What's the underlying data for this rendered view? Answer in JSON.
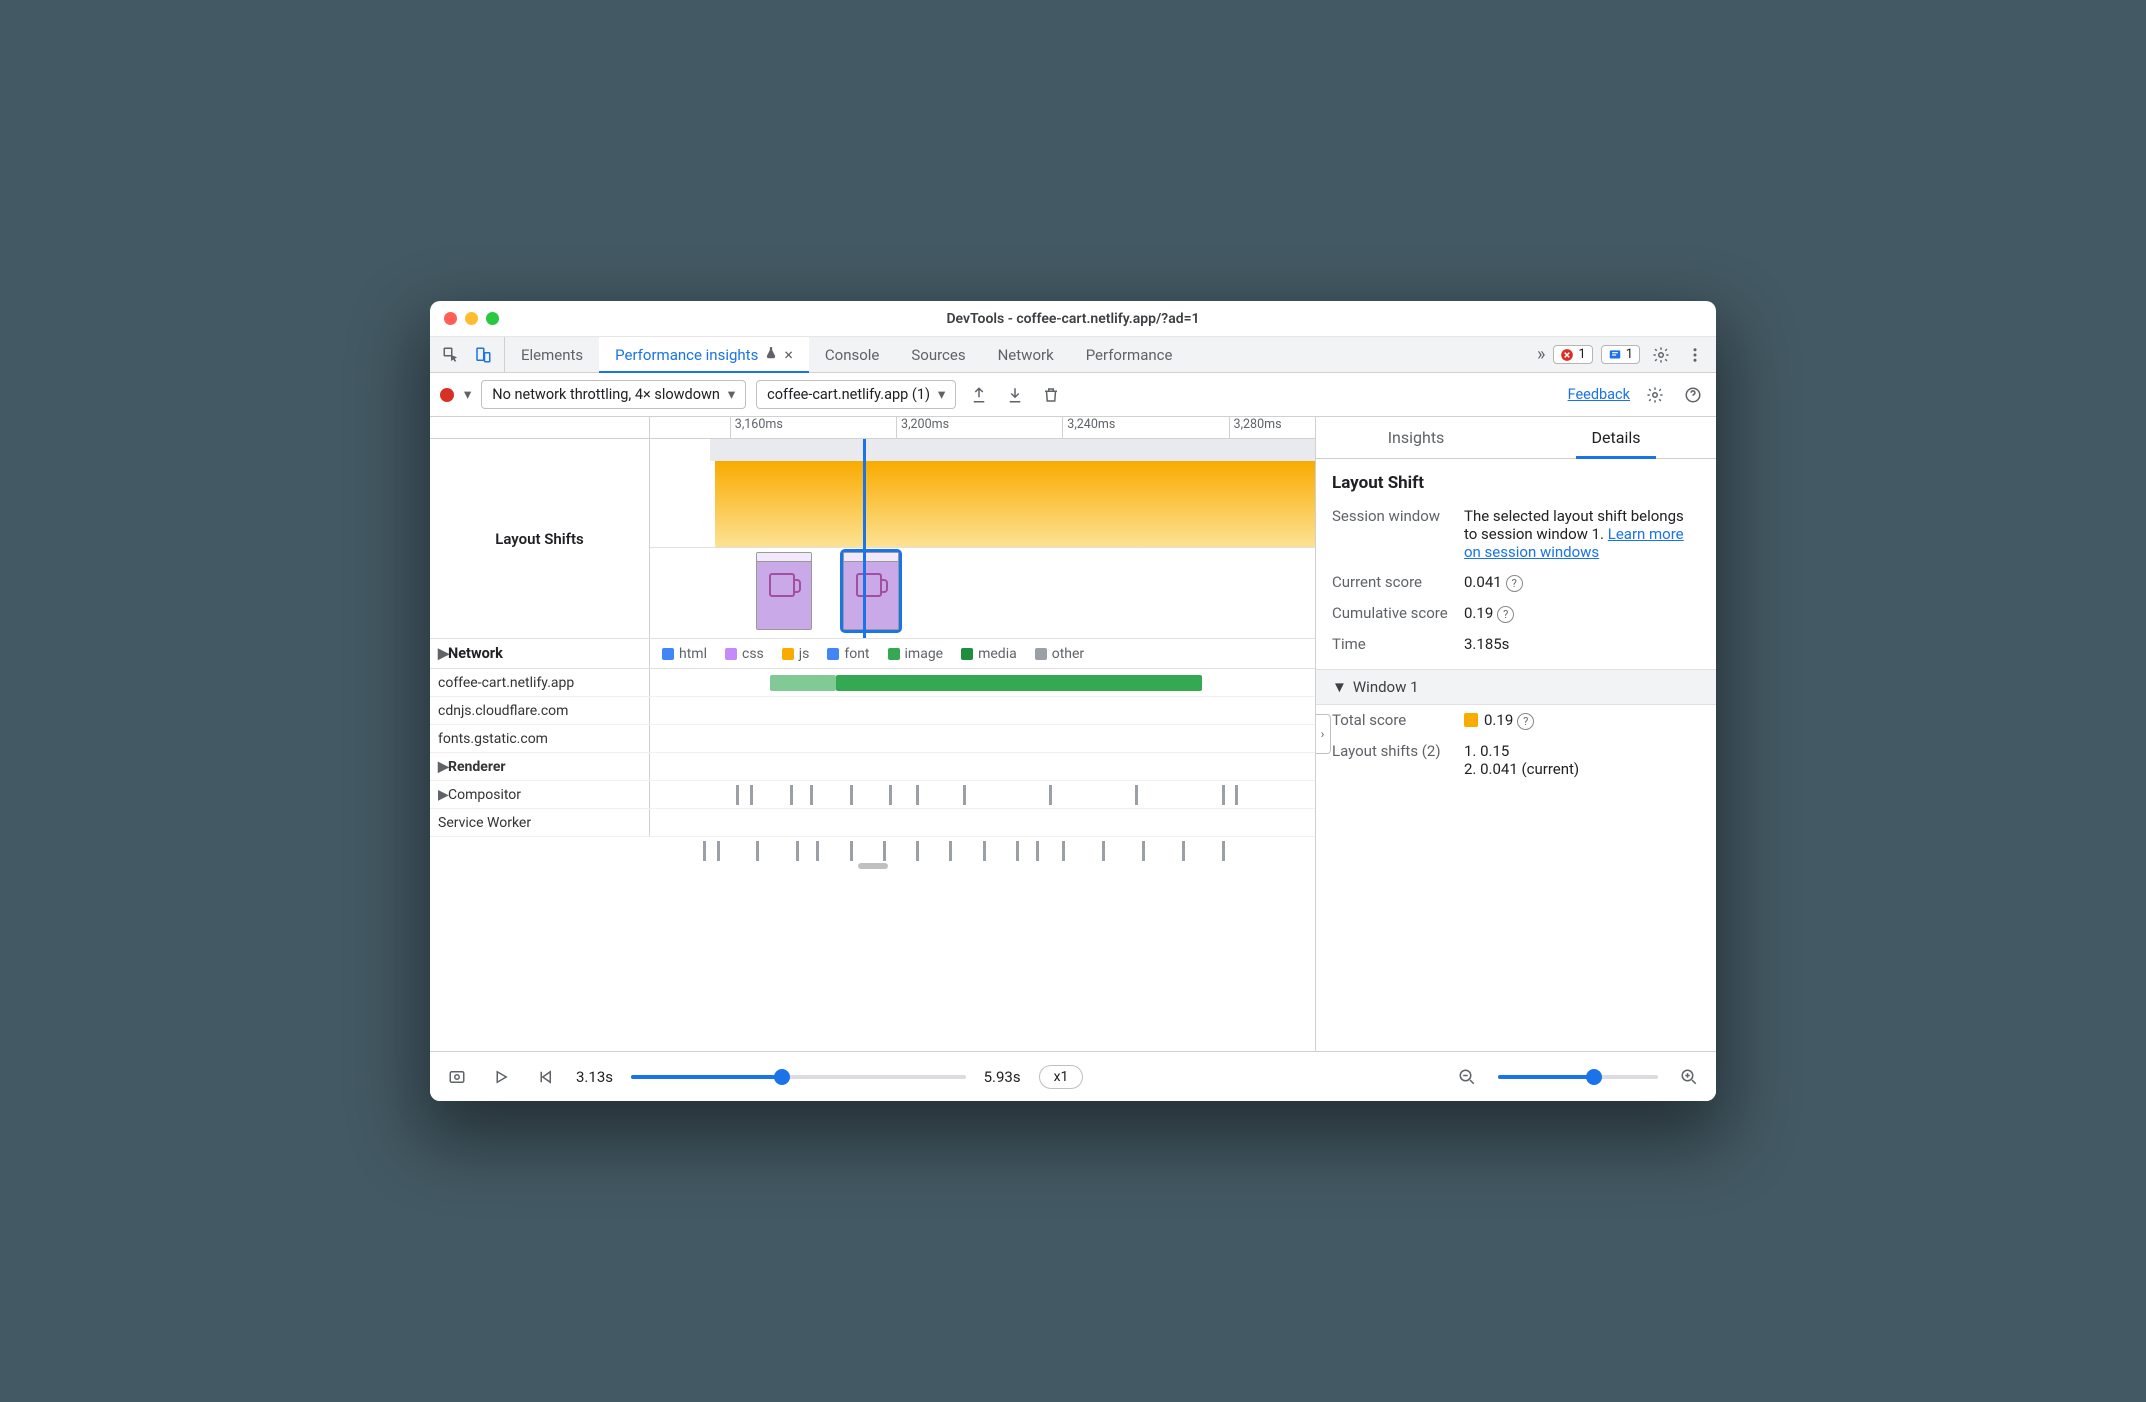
{
  "window": {
    "title": "DevTools - coffee-cart.netlify.app/?ad=1"
  },
  "tabs": {
    "items": [
      "Elements",
      "Performance insights",
      "Console",
      "Sources",
      "Network",
      "Performance"
    ],
    "active_index": 1,
    "close_visible": true,
    "errors": "1",
    "issues": "1"
  },
  "toolbar": {
    "throttling": "No network throttling, 4× slowdown",
    "recording": "coffee-cart.netlify.app (1)",
    "feedback": "Feedback"
  },
  "ruler": {
    "ticks": [
      {
        "label": "3,160ms",
        "left_pct": 12
      },
      {
        "label": "3,200ms",
        "left_pct": 37
      },
      {
        "label": "3,240ms",
        "left_pct": 62
      },
      {
        "label": "3,280ms",
        "left_pct": 87
      }
    ]
  },
  "layout_shifts": {
    "label": "Layout Shifts",
    "playhead_left_pct": 32,
    "thumbs": [
      {
        "left_pct": 16,
        "selected": false
      },
      {
        "left_pct": 29,
        "selected": true
      }
    ]
  },
  "network": {
    "label": "Network",
    "legend": [
      {
        "name": "html",
        "color": "#4285f4"
      },
      {
        "name": "css",
        "color": "#c58af9"
      },
      {
        "name": "js",
        "color": "#f9ab00"
      },
      {
        "name": "font",
        "color": "#4285f4"
      },
      {
        "name": "image",
        "color": "#34a853"
      },
      {
        "name": "media",
        "color": "#1e8e3e"
      },
      {
        "name": "other",
        "color": "#9aa0a6"
      }
    ],
    "rows": [
      {
        "host": "coffee-cart.netlify.app",
        "bars": [
          {
            "left_pct": 18,
            "width_pct": 10,
            "color": "#81c995"
          },
          {
            "left_pct": 28,
            "width_pct": 55,
            "color": "#34a853"
          }
        ]
      },
      {
        "host": "cdnjs.cloudflare.com",
        "bars": []
      },
      {
        "host": "fonts.gstatic.com",
        "bars": []
      }
    ]
  },
  "renderer": {
    "label": "Renderer",
    "compositor": "Compositor",
    "service_worker": "Service Worker",
    "ticks_pct": [
      13,
      15,
      21,
      24,
      30,
      36,
      40,
      47,
      60,
      73,
      86,
      88
    ]
  },
  "details": {
    "tabs": {
      "insights": "Insights",
      "details": "Details",
      "active": "details"
    },
    "title": "Layout Shift",
    "session_window_k": "Session window",
    "session_window_v_pre": "The selected layout shift belongs to session window 1. ",
    "session_window_link": "Learn more on session windows",
    "current_score_k": "Current score",
    "current_score_v": "0.041",
    "cumulative_k": "Cumulative score",
    "cumulative_v": "0.19",
    "time_k": "Time",
    "time_v": "3.185s",
    "window_section": "Window 1",
    "total_score_k": "Total score",
    "total_score_v": "0.19",
    "shifts_k": "Layout shifts (2)",
    "shift_1": "1. 0.15",
    "shift_2": "2. 0.041 (current)"
  },
  "bottom": {
    "start": "3.13s",
    "end": "5.93s",
    "speed": "x1",
    "range_slider_pct": 45,
    "zoom_slider_pct": 60
  }
}
